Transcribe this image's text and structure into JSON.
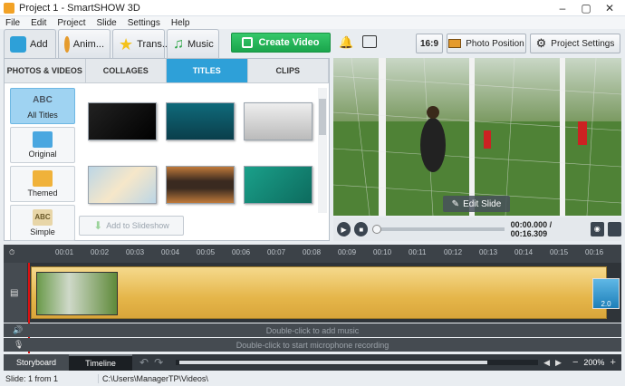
{
  "window": {
    "title": "Project 1 - SmartSHOW 3D",
    "minimize": "–",
    "restore": "▢",
    "close": "✕"
  },
  "menu": [
    "File",
    "Edit",
    "Project",
    "Slide",
    "Settings",
    "Help"
  ],
  "tabs": [
    {
      "label": "Add",
      "color": "#2ea0d8"
    },
    {
      "label": "Anim...",
      "color": "#e59b2d"
    },
    {
      "label": "Trans...",
      "color": "#f4c21b"
    },
    {
      "label": "Music",
      "color": "#27a341"
    }
  ],
  "toolbar": {
    "create_video": "Create Video",
    "aspect": "16:9",
    "photo_position": "Photo Position",
    "project_settings": "Project Settings"
  },
  "subtabs": [
    "PHOTOS & VIDEOS",
    "COLLAGES",
    "TITLES",
    "CLIPS"
  ],
  "active_subtab": "TITLES",
  "categories": [
    {
      "label": "All Titles",
      "icon_text": "ABC",
      "active": true
    },
    {
      "label": "Original",
      "icon_text": "",
      "active": false
    },
    {
      "label": "Themed",
      "icon_text": "",
      "active": false
    },
    {
      "label": "Simple",
      "icon_text": "ABC",
      "active": false
    }
  ],
  "add_to_slideshow": "Add to Slideshow",
  "preview": {
    "edit_slide": "Edit Slide"
  },
  "player": {
    "time": "00:00.000 / 00:16.309"
  },
  "ruler": [
    "00:01",
    "00:02",
    "00:03",
    "00:04",
    "00:05",
    "00:06",
    "00:07",
    "00:08",
    "00:09",
    "00:10",
    "00:11",
    "00:12",
    "00:13",
    "00:14",
    "00:15",
    "00:16"
  ],
  "timeline": {
    "transition_duration": "2.0",
    "music_hint": "Double-click to add music",
    "mic_hint": "Double-click to start microphone recording"
  },
  "bottom": {
    "storyboard": "Storyboard",
    "timeline": "Timeline",
    "zoom": "200%"
  },
  "status": {
    "slide": "Slide: 1 from 1",
    "path": "C:\\Users\\ManagerTP\\Videos\\"
  }
}
